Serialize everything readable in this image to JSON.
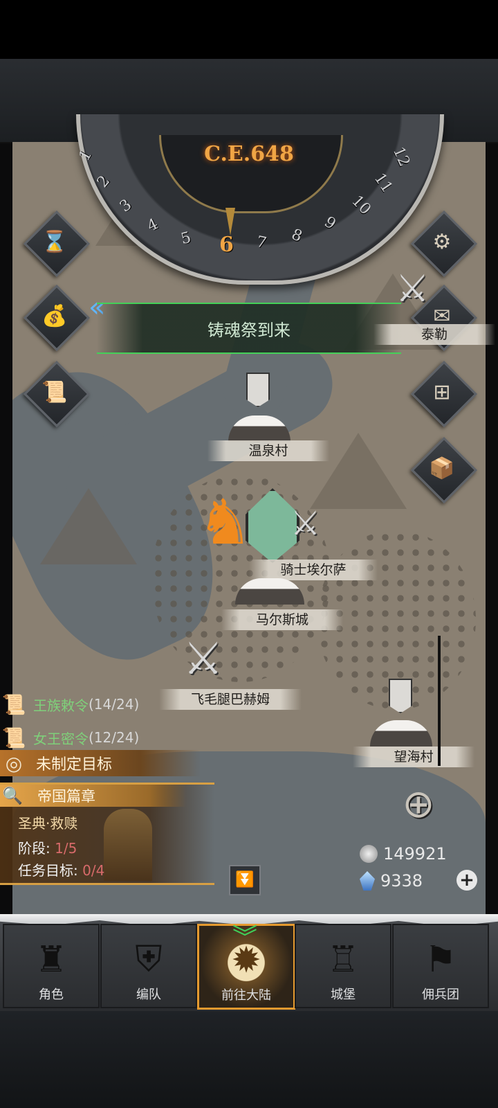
{
  "calendar": {
    "year": "C.E.648",
    "months": [
      "1",
      "2",
      "3",
      "4",
      "5",
      "6",
      "7",
      "8",
      "9",
      "10",
      "11",
      "12"
    ],
    "current_month": "6"
  },
  "event_banner": "铸魂祭到来",
  "map_places": {
    "hot_spring": "温泉村",
    "knight": "骑士埃尔萨",
    "mars_city": "马尔斯城",
    "bahum": "飞毛腿巴赫姆",
    "sea_village": "望海村",
    "tai": "泰勒"
  },
  "side_icons": {
    "hourglass": "hourglass-icon",
    "bag": "money-bag-icon",
    "scroll": "scroll-icon",
    "settings": "gear-icon",
    "mail": "mail-icon",
    "gate": "gate-icon",
    "supplies": "supplies-icon"
  },
  "quests": [
    {
      "label": "王族敕令",
      "progress": "(14/24)"
    },
    {
      "label": "女王密令",
      "progress": "(12/24)"
    }
  ],
  "goal": "未制定目标",
  "chapter": {
    "header": "帝国篇章",
    "title": "圣典·救赎",
    "stage_label": "阶段:",
    "stage_value": "1/5",
    "target_label": "任务目标:",
    "target_value": "0/4"
  },
  "currency": {
    "silver": "149921",
    "crystal": "9338"
  },
  "nav": [
    {
      "label": "角色",
      "icon": "knight-icon"
    },
    {
      "label": "编队",
      "icon": "helmet-icon"
    },
    {
      "label": "前往大陆",
      "icon": "continent-icon"
    },
    {
      "label": "城堡",
      "icon": "castle-icon"
    },
    {
      "label": "佣兵团",
      "icon": "mercenary-icon"
    }
  ],
  "colors": {
    "accent_orange": "#f0a545",
    "quest_green": "#7fd07a",
    "banner_green": "#44d058",
    "progress_red": "#d76a6a"
  }
}
